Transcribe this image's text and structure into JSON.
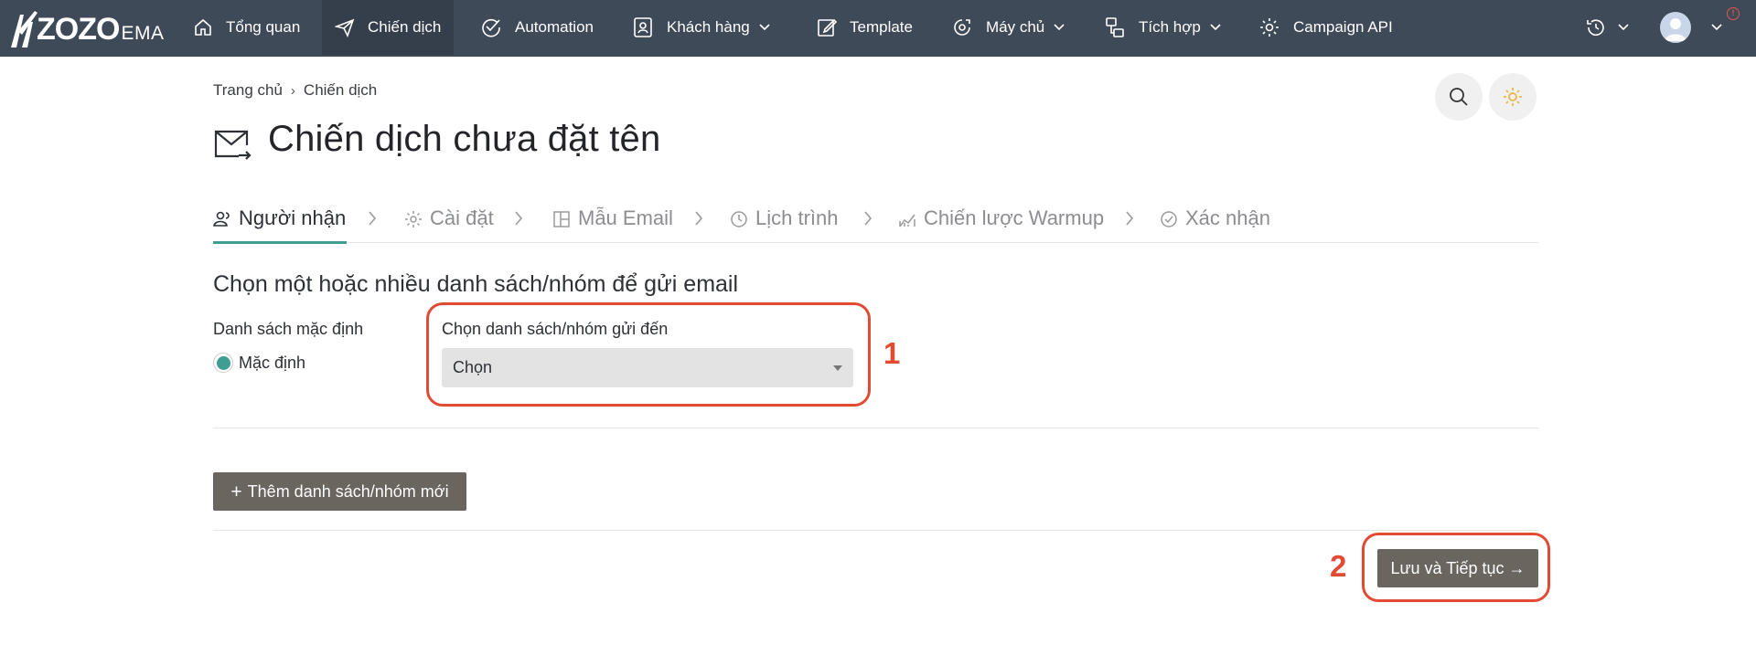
{
  "brand": {
    "logo_text": "ZOZO",
    "logo_suffix": "EMA"
  },
  "nav": {
    "items": [
      {
        "label": "Tổng quan",
        "icon": "home-icon"
      },
      {
        "label": "Chiến dịch",
        "icon": "send-icon",
        "active": true
      },
      {
        "label": "Automation",
        "icon": "check-circle-icon"
      },
      {
        "label": "Khách hàng",
        "icon": "contacts-icon",
        "dropdown": true
      },
      {
        "label": "Template",
        "icon": "edit-icon"
      },
      {
        "label": "Máy chủ",
        "icon": "server-cog-icon",
        "dropdown": true
      },
      {
        "label": "Tích hợp",
        "icon": "integration-icon",
        "dropdown": true
      },
      {
        "label": "Campaign API",
        "icon": "gear-icon"
      }
    ],
    "notification_badge": "!"
  },
  "breadcrumb": {
    "home": "Trang chủ",
    "separator": "›",
    "current": "Chiến dịch"
  },
  "page": {
    "title": "Chiến dịch chưa đặt tên"
  },
  "steps": [
    {
      "label": "Người nhận",
      "icon": "recipients-icon",
      "active": true
    },
    {
      "label": "Cài đặt",
      "icon": "gear-icon"
    },
    {
      "label": "Mẫu Email",
      "icon": "layout-icon"
    },
    {
      "label": "Lịch trình",
      "icon": "clock-icon"
    },
    {
      "label": "Chiến lược Warmup",
      "icon": "chart-icon"
    },
    {
      "label": "Xác nhận",
      "icon": "check-circle-icon"
    }
  ],
  "form": {
    "section_title": "Chọn một hoặc nhiều danh sách/nhóm để gửi email",
    "default_list_label": "Danh sách mặc định",
    "default_option": "Mặc định",
    "select_label": "Chọn danh sách/nhóm gửi đến",
    "select_value": "Chọn",
    "add_button": "Thêm danh sách/nhóm mới",
    "add_button_plus": "+",
    "save_button": "Lưu và Tiếp tục →"
  },
  "annotations": {
    "first": "1",
    "second": "2"
  },
  "colors": {
    "nav_bg": "#3f4a58",
    "accent": "#3f9e91",
    "button_bg": "#6b6560",
    "highlight": "#e34a34"
  }
}
